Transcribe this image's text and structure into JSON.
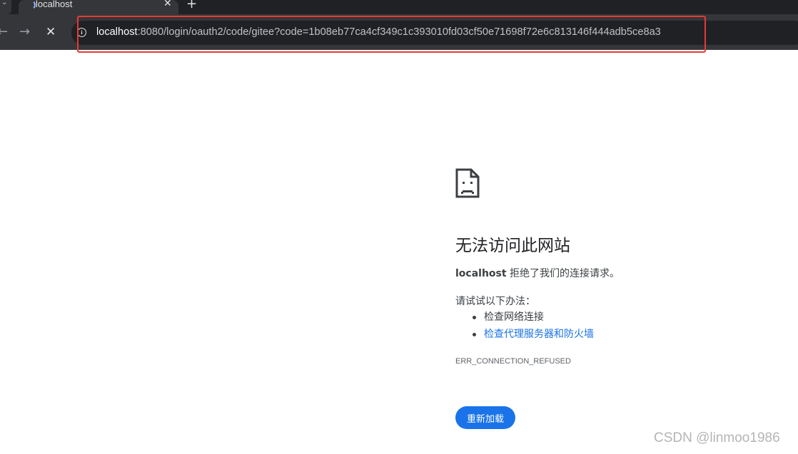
{
  "tab": {
    "title": "localhost",
    "close_glyph": "✕",
    "new_tab_glyph": "+",
    "tab_menu_glyph": "⌄"
  },
  "toolbar": {
    "back_glyph": "←",
    "forward_glyph": "→",
    "stop_glyph": "✕",
    "info_glyph": "i",
    "url_host": "localhost",
    "url_rest": ":8080/login/oauth2/code/gitee?code=1b08eb77ca4cf349c1c393010fd03cf50e71698f72e6c813146f444adb5ce8a3"
  },
  "error": {
    "title": "无法访问此网站",
    "host": "localhost",
    "description": " 拒绝了我们的连接请求。",
    "suggest_heading": "请试试以下办法：",
    "suggestions": [
      {
        "label": "检查网络连接",
        "link": false
      },
      {
        "label": "检查代理服务器和防火墙",
        "link": true
      }
    ],
    "code": "ERR_CONNECTION_REFUSED",
    "reload_label": "重新加载"
  },
  "watermark": "CSDN @linmoo1986",
  "colors": {
    "highlight": "#e53935",
    "accent": "#1a73e8",
    "toolbar": "#35363a",
    "tabstrip": "#202124"
  }
}
